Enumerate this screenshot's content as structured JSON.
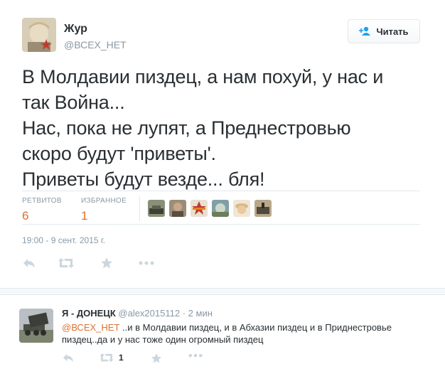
{
  "tweet": {
    "author_name": "Жур",
    "author_handle": "@ВСЕХ_НЕТ",
    "follow_label": "Читать",
    "text_lines": [
      "В Молдавии пиздец, а нам похуй, у нас и",
      "так Война...",
      "Нас, пока не лупят, а Преднестровью",
      "скоро будут 'приветы'.",
      "Приветы будут везде... бля!"
    ],
    "retweets_label": "РЕТВИТОВ",
    "retweets_count": "6",
    "favorites_label": "ИЗБРАННОЕ",
    "favorites_count": "1",
    "timestamp": "19:00 - 9 сент. 2015 г.",
    "actions": [
      "reply-icon",
      "retweet-icon",
      "favorite-icon",
      "more-icon"
    ]
  },
  "reply": {
    "author_name": "Я - ДОНЕЦК",
    "author_handle": "@alex2015112",
    "time": "· 2 мин",
    "mention": "@ВСЕХ_НЕТ",
    "text_line1": " ..и в Молдавии пиздец, и в Абхазии пиздец и в Приднестровье",
    "text_line2": "пиздец..да и у нас тоже один огромный пиздец",
    "retweet_count": "1",
    "actions": [
      "reply-icon",
      "retweet-icon",
      "favorite-icon",
      "more-icon"
    ]
  },
  "colors": {
    "accent": "#e0712f",
    "text": "#292f33",
    "muted": "#8899a6",
    "border": "#e1e8ed",
    "icon": "#ccd6dd"
  }
}
